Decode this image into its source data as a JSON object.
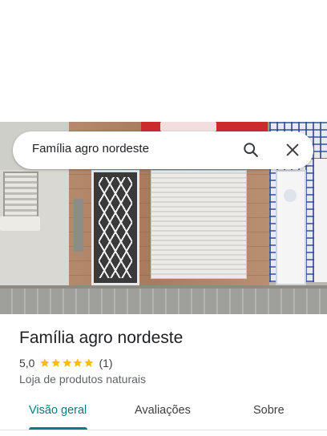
{
  "search": {
    "query": "Família agro nordeste",
    "icons": {
      "search": "search-icon",
      "close": "close-icon"
    }
  },
  "place": {
    "name": "Família agro nordeste",
    "rating": "5,0",
    "stars": 5,
    "review_count": "(1)",
    "category": "Loja de produtos naturais"
  },
  "tabs": {
    "items": [
      {
        "label": "Visão geral",
        "active": true
      },
      {
        "label": "Avaliações",
        "active": false
      },
      {
        "label": "Sobre",
        "active": false
      }
    ]
  },
  "colors": {
    "accent": "#0b7a83",
    "star": "#fbbc04",
    "text_primary": "#202124",
    "text_secondary": "#5f6368"
  }
}
